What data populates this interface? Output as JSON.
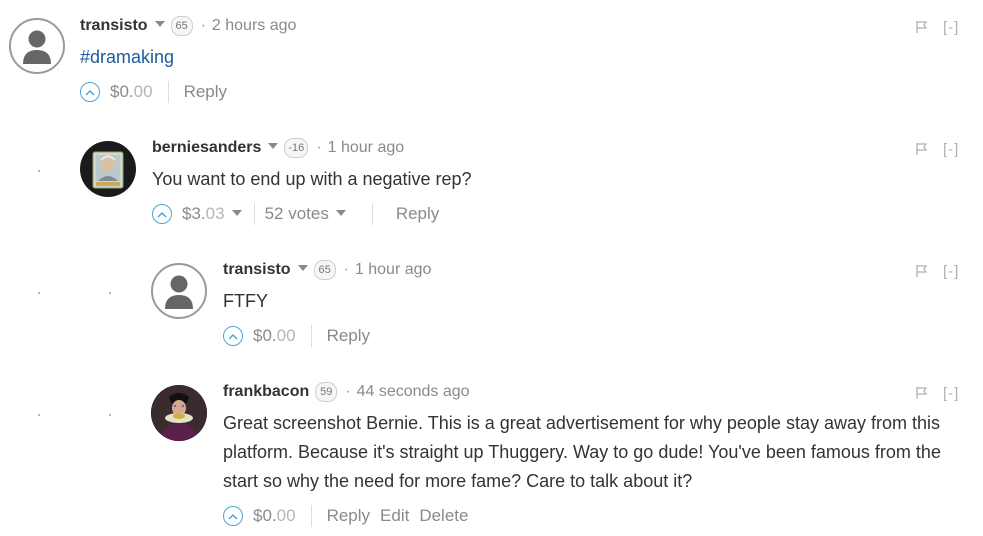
{
  "comments": [
    {
      "author": "transisto",
      "reputation": "65",
      "time": "2 hours ago",
      "body": "#dramaking",
      "payout_main": "$0.",
      "payout_cents": "00",
      "reply_label": "Reply",
      "flag_label": "[-]",
      "avatar": "default-user-icon"
    },
    {
      "author": "berniesanders",
      "reputation": "-16",
      "time": "1 hour ago",
      "body": "You want to end up with a negative rep?",
      "payout_main": "$3.",
      "payout_cents": "03",
      "votes": "52 votes",
      "reply_label": "Reply",
      "flag_label": "[-]",
      "avatar": "bernie-portrait"
    },
    {
      "author": "transisto",
      "reputation": "65",
      "time": "1 hour ago",
      "body": "FTFY",
      "payout_main": "$0.",
      "payout_cents": "00",
      "reply_label": "Reply",
      "flag_label": "[-]",
      "avatar": "default-user-icon"
    },
    {
      "author": "frankbacon",
      "reputation": "59",
      "time": "44 seconds ago",
      "body": "Great screenshot Bernie. This is a great advertisement for why people stay away from this platform. Because it's straight up Thuggery. Way to go dude! You've been famous from the start so why the need for more fame? Care to talk about it?",
      "payout_main": "$0.",
      "payout_cents": "00",
      "reply_label": "Reply",
      "edit_label": "Edit",
      "delete_label": "Delete",
      "flag_label": "[-]",
      "avatar": "francis-bacon-portrait"
    }
  ],
  "colors": {
    "accent": "#4aa7d6",
    "tag_link": "#1f5a9c",
    "muted": "#8a8a8a"
  }
}
